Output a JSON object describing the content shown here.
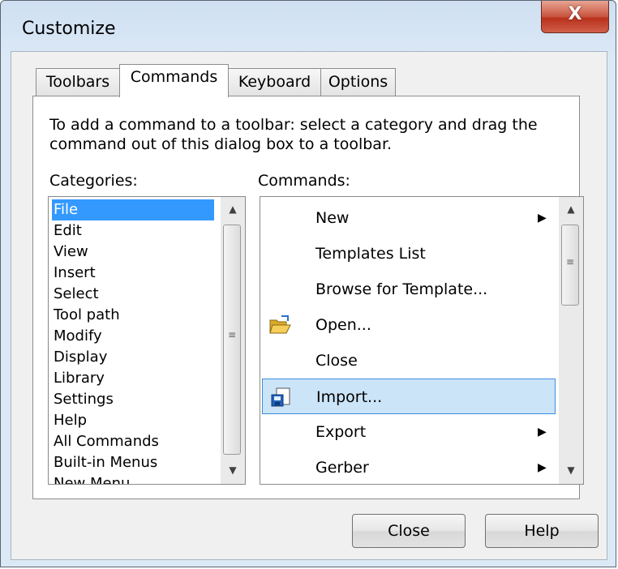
{
  "window": {
    "title": "Customize",
    "close_glyph": "X"
  },
  "tabs": [
    {
      "label": "Toolbars"
    },
    {
      "label": "Commands"
    },
    {
      "label": "Keyboard"
    },
    {
      "label": "Options"
    }
  ],
  "instructions": "To add a command to a toolbar: select a category and drag the command out of this dialog box to a toolbar.",
  "categories": {
    "label": "Categories:",
    "selected": "File",
    "items": [
      "File",
      "Edit",
      "View",
      "Insert",
      "Select",
      "Tool path",
      "Modify",
      "Display",
      "Library",
      "Settings",
      "Help",
      "All Commands",
      "Built-in Menus",
      "New Menu"
    ]
  },
  "commands": {
    "label": "Commands:",
    "highlighted": "Import...",
    "items": [
      {
        "label": "New",
        "icon": "",
        "submenu": true
      },
      {
        "label": "Templates List",
        "icon": "",
        "submenu": false
      },
      {
        "label": "Browse for Template...",
        "icon": "",
        "submenu": false
      },
      {
        "label": "Open...",
        "icon": "open-folder-icon",
        "submenu": false
      },
      {
        "label": "Close",
        "icon": "",
        "submenu": false
      },
      {
        "label": "Import...",
        "icon": "import-icon",
        "submenu": false
      },
      {
        "label": "Export",
        "icon": "",
        "submenu": true
      },
      {
        "label": "Gerber",
        "icon": "",
        "submenu": true
      }
    ]
  },
  "buttons": {
    "close": "Close",
    "help": "Help"
  },
  "glyphs": {
    "scroll_up": "▲",
    "scroll_down": "▼",
    "grip": "≡",
    "submenu_arrow": "▶"
  },
  "colors": {
    "selection": "#3399ff",
    "highlight_bg": "#cce4f7",
    "highlight_border": "#3d8ee0",
    "close_button": "#c8553f"
  }
}
